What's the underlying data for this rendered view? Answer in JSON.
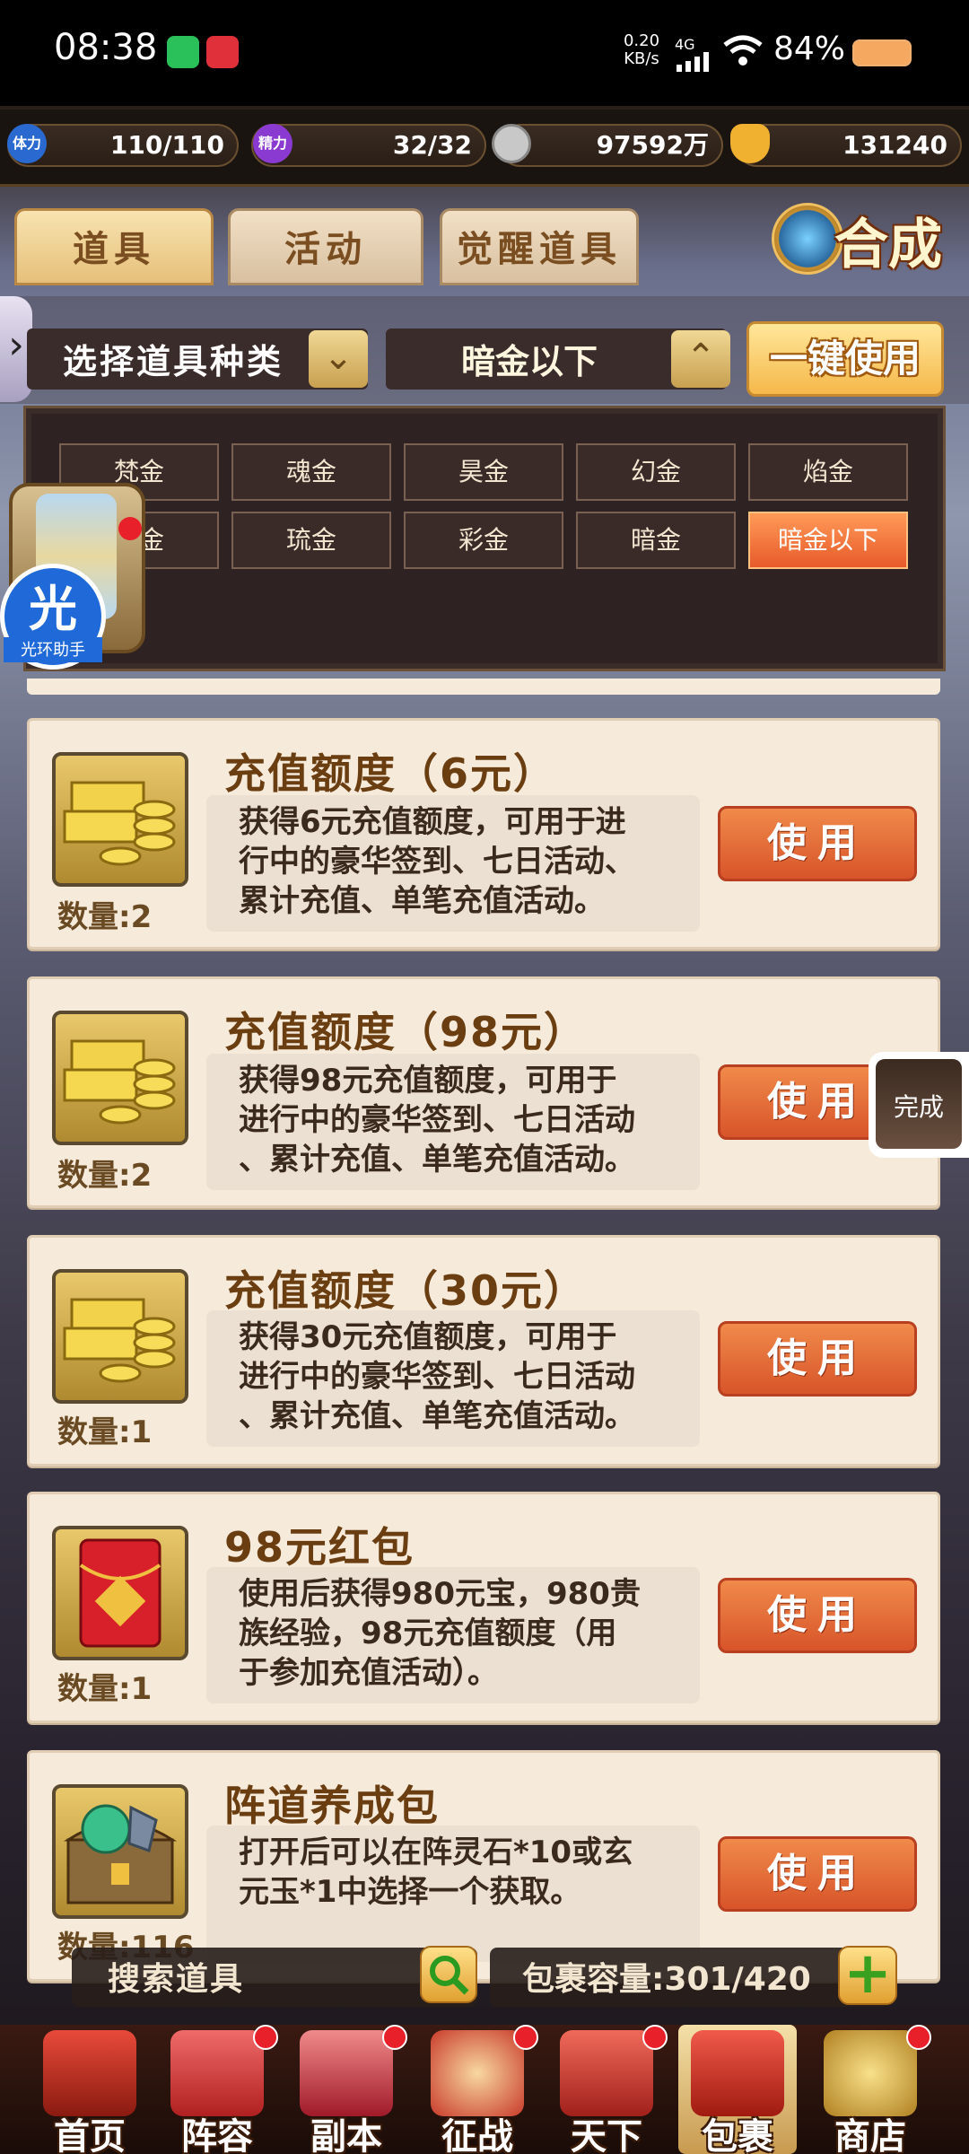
{
  "status_bar": {
    "time": "08:38",
    "net_speed_value": "0.20",
    "net_speed_unit": "KB/s",
    "network": "4G",
    "battery": "84%",
    "apps": [
      "wechat-icon",
      "notification-app-icon"
    ]
  },
  "resources": {
    "stamina_label": "体力",
    "stamina": "110/110",
    "energy_label": "精力",
    "energy": "32/32",
    "coins": "97592万",
    "ingots": "131240"
  },
  "tabs": [
    {
      "label": "道具",
      "selected": true
    },
    {
      "label": "活动",
      "selected": false
    },
    {
      "label": "觉醒道具",
      "selected": false
    }
  ],
  "synthesize": {
    "label": "合成"
  },
  "filters": {
    "type_label": "选择道具种类",
    "grade_label": "暗金以下",
    "use_all_label": "一键使用"
  },
  "grades": [
    {
      "label": "梵金"
    },
    {
      "label": "魂金"
    },
    {
      "label": "昊金"
    },
    {
      "label": "幻金"
    },
    {
      "label": "焰金"
    },
    {
      "label": "云金"
    },
    {
      "label": "琉金"
    },
    {
      "label": "彩金"
    },
    {
      "label": "暗金"
    },
    {
      "label": "暗金以下",
      "selected": true
    }
  ],
  "helper": {
    "char": "光",
    "label": "光环助手"
  },
  "done_float": {
    "label": "完成"
  },
  "items": [
    {
      "title": "充值额度（6元）",
      "desc": [
        "获得6元充值额度，可用于进",
        "行中的豪华签到、七日活动、",
        "累计充值、单笔充值活动。"
      ],
      "qty": "数量:2",
      "use_label": "使用",
      "icon": "gold-bars-icon"
    },
    {
      "title": "充值额度（98元）",
      "desc": [
        "获得98元充值额度，可用于",
        "进行中的豪华签到、七日活动",
        "、累计充值、单笔充值活动。"
      ],
      "qty": "数量:2",
      "use_label": "使用",
      "icon": "gold-bars-icon"
    },
    {
      "title": "充值额度（30元）",
      "desc": [
        "获得30元充值额度，可用于",
        "进行中的豪华签到、七日活动",
        "、累计充值、单笔充值活动。"
      ],
      "qty": "数量:1",
      "use_label": "使用",
      "icon": "gold-bars-icon"
    },
    {
      "title": "98元红包",
      "desc": [
        "使用后获得980元宝，980贵",
        "族经验，98元充值额度（用",
        "于参加充值活动）。"
      ],
      "qty": "数量:1",
      "use_label": "使用",
      "icon": "red-envelope-icon"
    },
    {
      "title": "阵道养成包",
      "desc": [
        "打开后可以在阵灵石*10或玄",
        "元玉*1中选择一个获取。"
      ],
      "qty": "数量:116",
      "use_label": "使用",
      "icon": "treasure-chest-icon"
    }
  ],
  "search": {
    "label": "搜索道具"
  },
  "capacity": {
    "label": "包裹容量:301/420"
  },
  "nav": [
    {
      "label": "首页",
      "dot": false
    },
    {
      "label": "阵容",
      "dot": true
    },
    {
      "label": "副本",
      "dot": true
    },
    {
      "label": "征战",
      "dot": true
    },
    {
      "label": "天下",
      "dot": true
    },
    {
      "label": "包裹",
      "dot": false,
      "selected": true
    },
    {
      "label": "商店",
      "dot": true
    }
  ],
  "colors": {
    "accent_orange": "#e85a2a",
    "gold": "#f5b84a",
    "card_bg": "#f6eadb",
    "title_brown": "#6a3e10"
  }
}
